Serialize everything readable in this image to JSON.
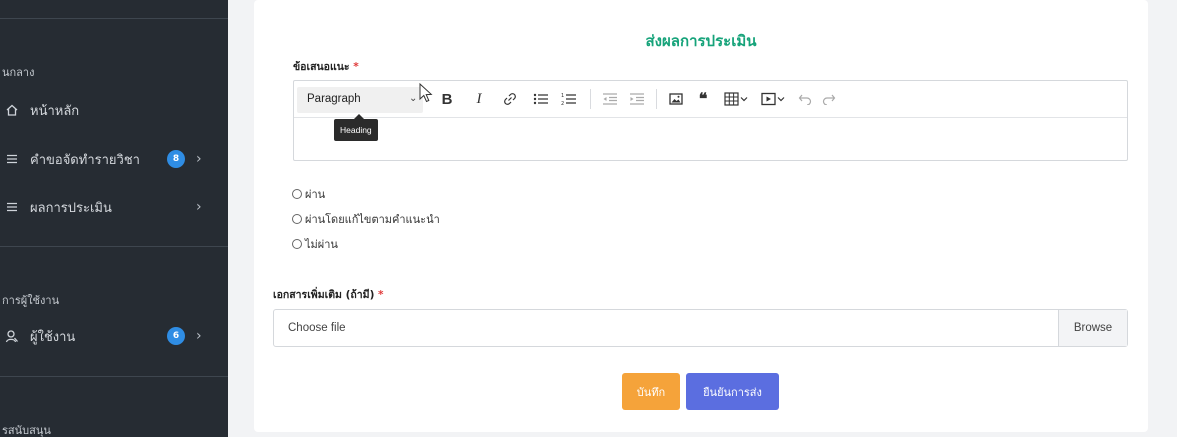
{
  "sidebar": {
    "section1": "นกลาง",
    "items": [
      {
        "label": "หน้าหลัก",
        "icon": "home-icon"
      },
      {
        "label": "คำขอจัดทำรายวิชา",
        "icon": "list-icon",
        "badge": "8"
      },
      {
        "label": "ผลการประเมิน",
        "icon": "list-icon"
      }
    ],
    "section2": "การผู้ใช้งาน",
    "items2": [
      {
        "label": "ผู้ใช้งาน",
        "icon": "user-icon",
        "badge": "6"
      }
    ],
    "section3": "รสนับสนุน"
  },
  "form": {
    "title": "ส่งผลการประเมิน",
    "suggestion_label": "ข้อเสนอแนะ",
    "required_mark": "*",
    "editor": {
      "format_select": "Paragraph",
      "tooltip": "Heading",
      "tools": [
        "bold-icon",
        "italic-icon",
        "link-icon",
        "bulleted-list-icon",
        "numbered-list-icon",
        "outdent-icon",
        "indent-icon",
        "image-icon",
        "blockquote-icon",
        "table-icon",
        "media-icon",
        "undo-icon",
        "redo-icon"
      ]
    },
    "radio_options": [
      "ผ่าน",
      "ผ่านโดยแก้ไขตามคำแนะนำ",
      "ไม่ผ่าน"
    ],
    "attachment_label": "เอกสารเพิ่มเติม (ถ้ามี)",
    "file_placeholder": "Choose file",
    "browse_label": "Browse",
    "save_label": "บันทึก",
    "submit_label": "ยืนยันการส่ง"
  },
  "colors": {
    "sidebar_bg": "#262c33",
    "title": "#16a37a",
    "badge": "#2f8de4",
    "save_button": "#f5a33a",
    "submit_button": "#5b6ee0"
  }
}
